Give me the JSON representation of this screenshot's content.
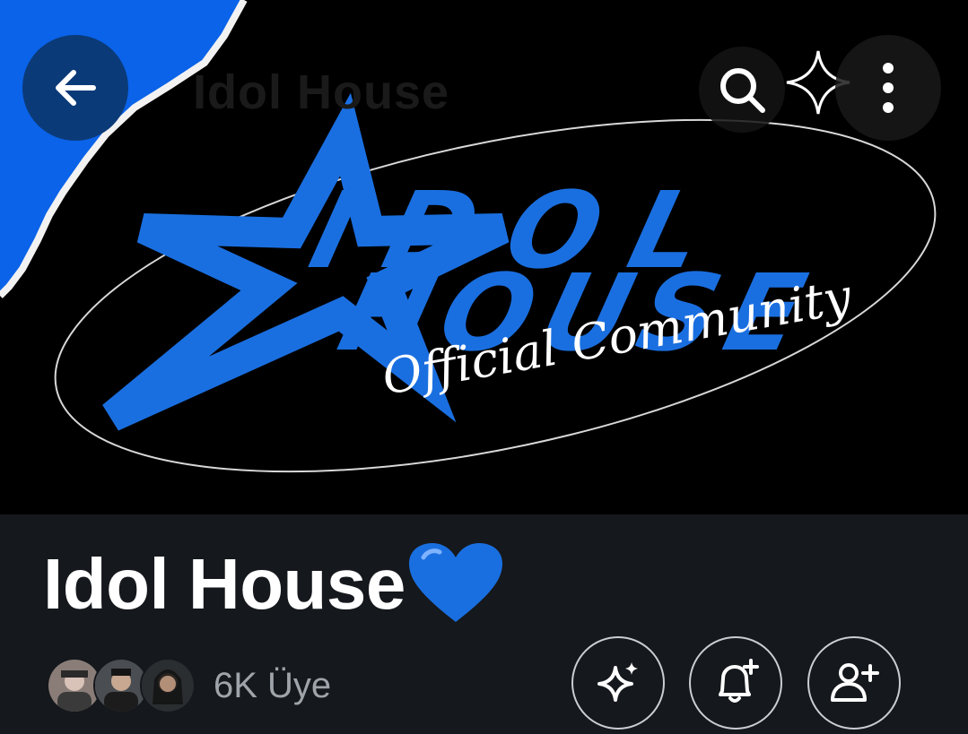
{
  "community": {
    "header_ghost_title": "Idol House",
    "name": "Idol House",
    "name_emoji": "💙",
    "member_count": "6K Üye"
  },
  "banner": {
    "logo_line1": "IDOL",
    "logo_line2": "HOUSE",
    "logo_tagline": "Official Community",
    "accent_color": "#1a6fe0",
    "corner_color": "#0a63e8"
  },
  "icons": {
    "back": "arrow-left-icon",
    "search": "search-icon",
    "more": "more-vertical-icon",
    "ai": "sparkle-icon",
    "notify": "bell-plus-icon",
    "join": "person-plus-icon"
  }
}
